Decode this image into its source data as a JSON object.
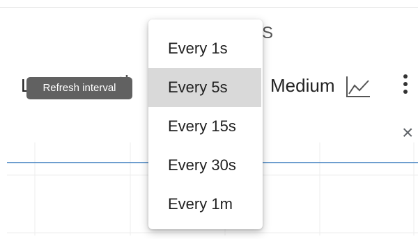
{
  "header": {
    "title_fragment": "S",
    "left_label_fragment": "L",
    "size_label": "Medium",
    "tooltip": "Refresh interval"
  },
  "icons": {
    "refresh": "refresh-icon",
    "chart_type": "line-chart-icon",
    "more": "more-vertical-icon",
    "close": "close-icon"
  },
  "refresh_menu": {
    "items": [
      "Every 1s",
      "Every 5s",
      "Every 15s",
      "Every 30s",
      "Every 1m"
    ],
    "selected": "Every 5s"
  },
  "chart": {
    "line_color": "#3f7fbf",
    "grid_color": "#eeeeee"
  }
}
